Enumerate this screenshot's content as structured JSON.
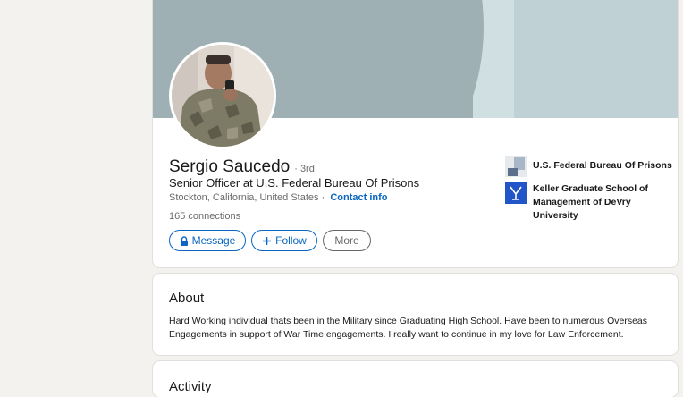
{
  "profile": {
    "name": "Sergio Saucedo",
    "degree": "· 3rd",
    "headline": "Senior Officer at U.S. Federal Bureau Of Prisons",
    "location": "Stockton, California, United States ·",
    "contact_info_label": "Contact info",
    "connections": "165 connections"
  },
  "actions": {
    "message_label": "Message",
    "follow_label": "Follow",
    "more_label": "More"
  },
  "organizations": [
    {
      "name": "U.S. Federal Bureau Of Prisons",
      "icon": "company-logo"
    },
    {
      "name": "Keller Graduate School of Management of DeVry University",
      "icon": "school-logo"
    }
  ],
  "about": {
    "title": "About",
    "text": "Hard Working individual thats been in the Military since Graduating High School. Have been to numerous Overseas Engagements in support of War Time engagements. I really want to continue in my love for Law Enforcement."
  },
  "activity": {
    "title": "Activity"
  },
  "colors": {
    "accent": "#0a66c2",
    "page_bg": "#f3f2ef",
    "banner_dark": "#9fb0b4",
    "banner_light": "#cfdfe2"
  }
}
